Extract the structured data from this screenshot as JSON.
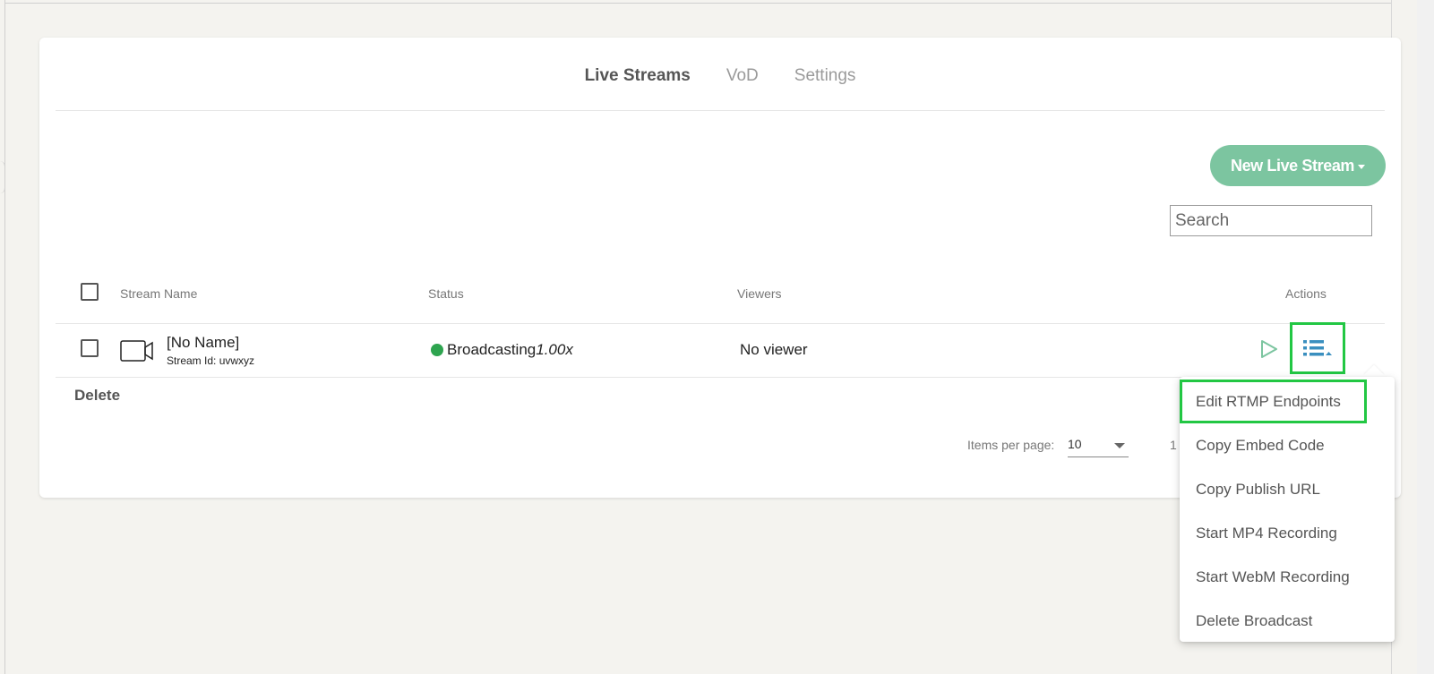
{
  "tabs": [
    {
      "label": "Live Streams"
    },
    {
      "label": "VoD"
    },
    {
      "label": "Settings"
    }
  ],
  "new_stream_button": {
    "label": "New Live Stream"
  },
  "search": {
    "placeholder": "Search",
    "value": ""
  },
  "table": {
    "headers": {
      "stream_name": "Stream Name",
      "status": "Status",
      "viewers": "Viewers",
      "actions": "Actions"
    },
    "rows": [
      {
        "name": "[No Name]",
        "stream_id": "Stream Id: uvwxyz",
        "status": "Broadcasting",
        "speed": "1.00x",
        "viewers": "No viewer"
      }
    ]
  },
  "delete_label": "Delete",
  "pagination": {
    "items_per_page_label": "Items per page:",
    "items_per_page_value": "10",
    "range_text": "1"
  },
  "actions_menu": {
    "items": [
      {
        "label": "Edit RTMP Endpoints"
      },
      {
        "label": "Copy Embed Code"
      },
      {
        "label": "Copy Publish URL"
      },
      {
        "label": "Start MP4 Recording"
      },
      {
        "label": "Start WebM Recording"
      },
      {
        "label": "Delete Broadcast"
      }
    ]
  },
  "colors": {
    "accent_green": "#7cc5a0",
    "status_green": "#2ea44f",
    "highlight_green": "#22c743",
    "action_icon_blue": "#3a8fbf"
  }
}
